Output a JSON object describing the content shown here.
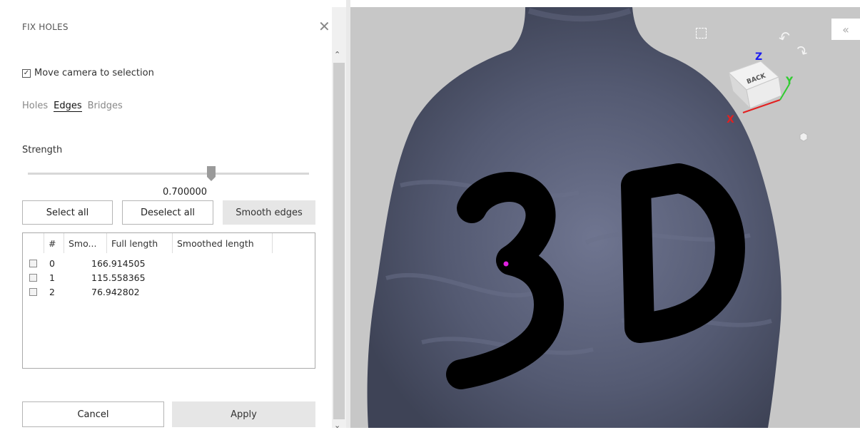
{
  "panel": {
    "title": "FIX HOLES",
    "close_icon": "close-icon",
    "move_camera": {
      "label": "Move camera to selection",
      "checked": true,
      "check_glyph": "✓"
    },
    "tabs": [
      {
        "label": "Holes",
        "active": false
      },
      {
        "label": "Edges",
        "active": true
      },
      {
        "label": "Bridges",
        "active": false
      }
    ],
    "strength": {
      "label": "Strength",
      "value": "0.700000",
      "fraction": 0.7
    },
    "buttons": {
      "select_all": "Select all",
      "deselect_all": "Deselect all",
      "smooth_edges": "Smooth edges"
    },
    "table": {
      "headers": [
        "#",
        "Smo...",
        "Full length",
        "Smoothed length"
      ],
      "rows": [
        {
          "index": "0",
          "smoothed": "",
          "full_length": "166.914505",
          "smoothed_length": ""
        },
        {
          "index": "1",
          "smoothed": "",
          "full_length": "115.558365",
          "smoothed_length": ""
        },
        {
          "index": "2",
          "smoothed": "",
          "full_length": "76.942802",
          "smoothed_length": ""
        }
      ]
    },
    "footer": {
      "cancel": "Cancel",
      "apply": "Apply"
    },
    "scroll_up_glyph": "⌃",
    "scroll_down_glyph": "⌄"
  },
  "viewport": {
    "model_text": "3D",
    "orientation_cube": {
      "face_label": "BACK",
      "axes": [
        "X",
        "Y",
        "Z"
      ],
      "colors": {
        "x": "#e32020",
        "y": "#2fcc2f",
        "z": "#1c1cf0"
      }
    },
    "collapse_glyph": "«",
    "background": "#c7c7c7",
    "model_color": "#4e5366"
  }
}
